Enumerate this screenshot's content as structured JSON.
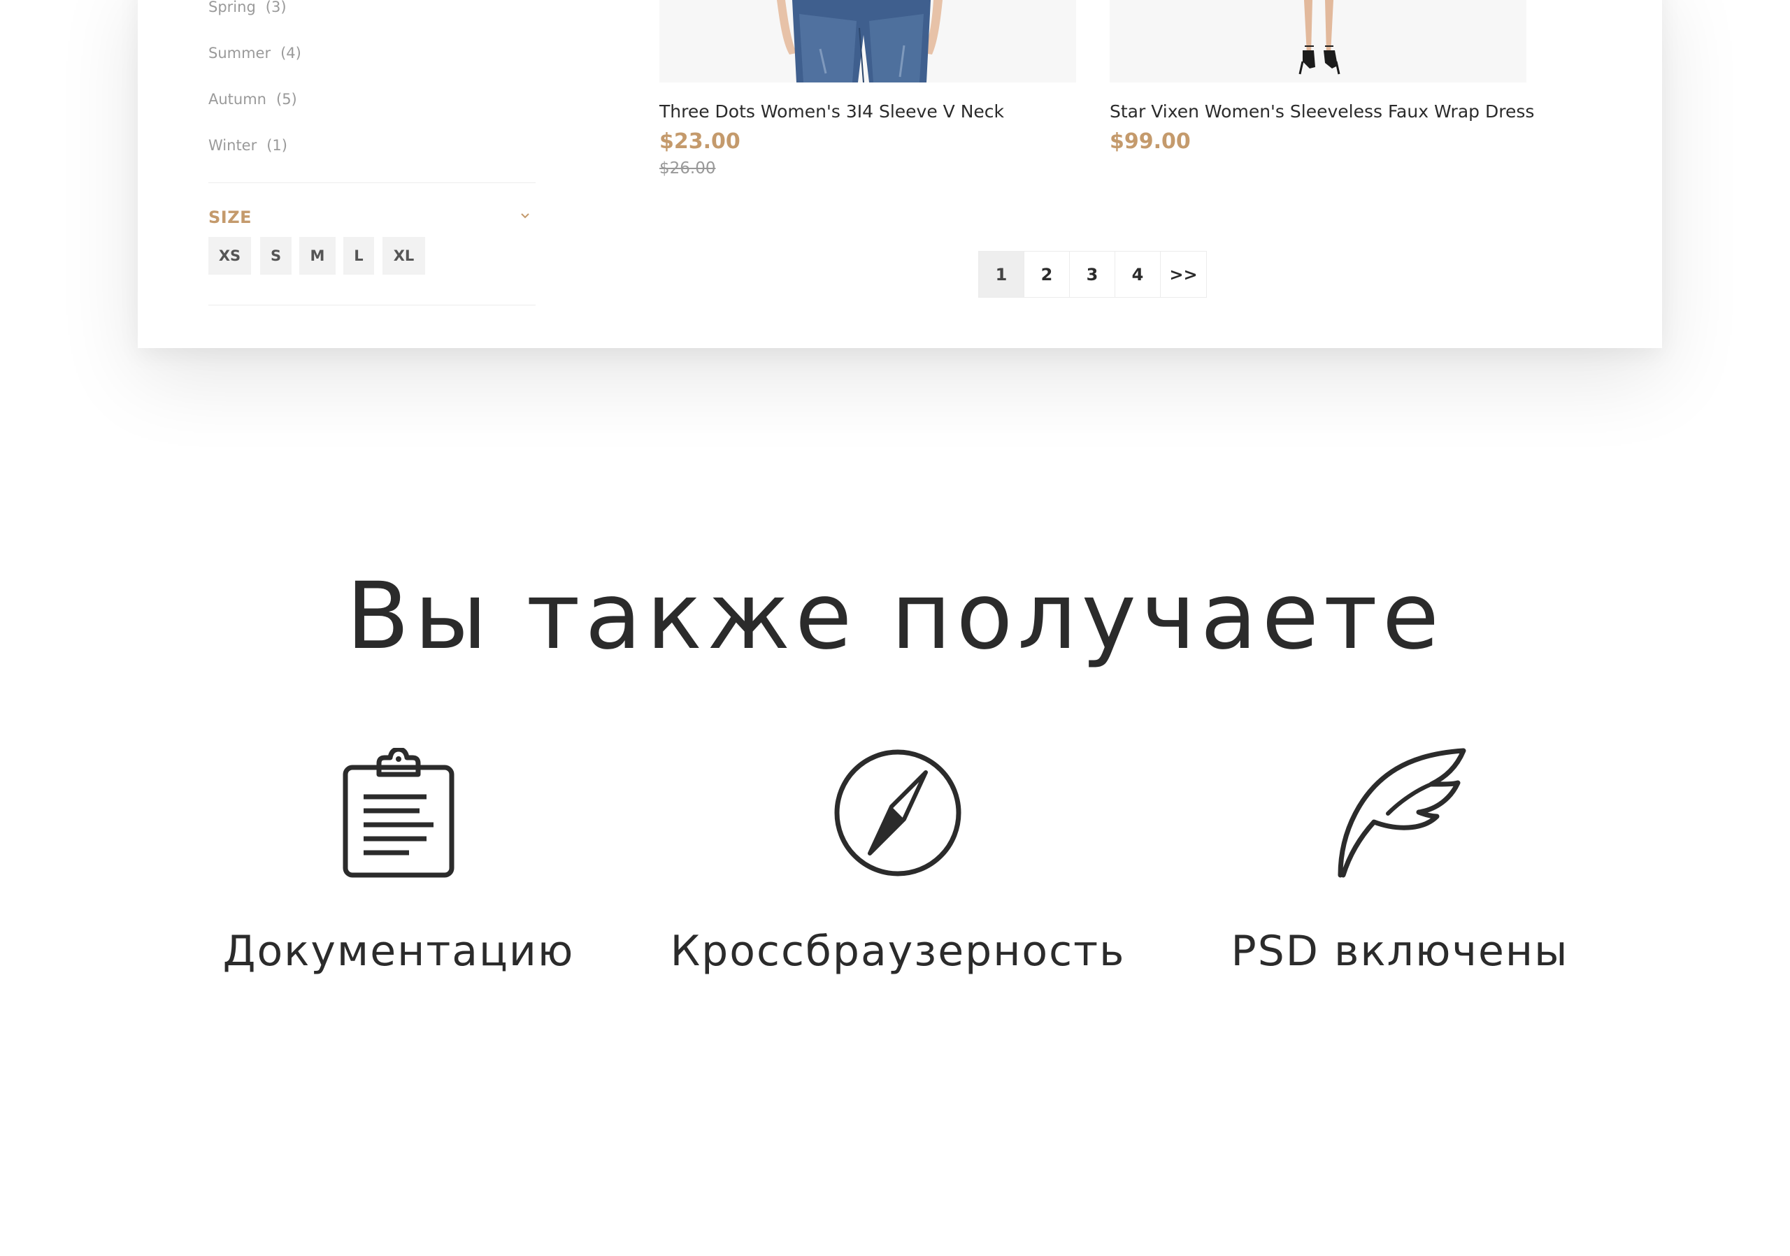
{
  "sidebar": {
    "seasons": [
      {
        "label": "Spring",
        "count": "(3)"
      },
      {
        "label": "Summer",
        "count": "(4)"
      },
      {
        "label": "Autumn",
        "count": "(5)"
      },
      {
        "label": "Winter",
        "count": "(1)"
      }
    ],
    "size_title": "SIZE",
    "sizes": [
      "XS",
      "S",
      "M",
      "L",
      "XL"
    ]
  },
  "products": [
    {
      "name": "Three Dots Women's 3I4 Sleeve V Neck",
      "price": "$23.00",
      "old_price": "$26.00"
    },
    {
      "name": "Star Vixen Women's Sleeveless Faux Wrap Dress",
      "price": "$99.00"
    }
  ],
  "pagination": {
    "pages": [
      "1",
      "2",
      "3",
      "4"
    ],
    "next": ">>",
    "active": "1"
  },
  "features": {
    "title": "Вы также получаете",
    "items": [
      {
        "label": "Документацию",
        "icon": "clipboard-icon"
      },
      {
        "label": "Кроссбраузерность",
        "icon": "compass-icon"
      },
      {
        "label": "PSD включены",
        "icon": "feather-icon"
      }
    ]
  },
  "colors": {
    "accent": "#c49a6c",
    "text": "#2b2b2b",
    "muted": "#9a9a9a",
    "chip_bg": "#f2f2f2"
  }
}
